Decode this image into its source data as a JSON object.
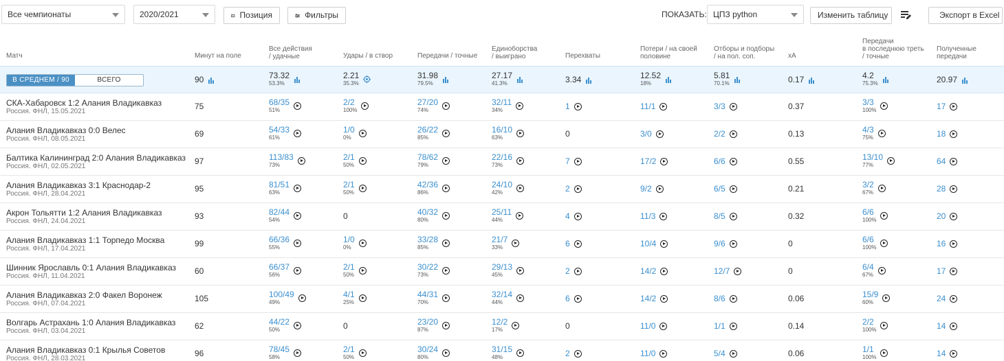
{
  "toolbar": {
    "championship": "Все чемпионаты",
    "season": "2020/2021",
    "position_label": "Позиция",
    "filters_label": "Фильтры",
    "show_label": "ПОКАЗАТЬ:",
    "show_value": "ЦПЗ python",
    "change_table_label": "Изменить таблицу",
    "export_label": "Экспорт в Excel"
  },
  "headers": [
    [
      "Матч"
    ],
    [
      "Минут на поле"
    ],
    [
      "Все действия",
      "/ удачные"
    ],
    [
      "Удары / в створ"
    ],
    [
      "Передачи / точные"
    ],
    [
      "Единоборства",
      "/ выиграно"
    ],
    [
      "Перехваты"
    ],
    [
      "Потери / на своей",
      "половине"
    ],
    [
      "Отборы и подборы",
      "/ на пол. соп."
    ],
    [
      "xA"
    ],
    [
      "Передачи",
      "в последнюю треть",
      "/ точные"
    ],
    [
      "Полученные",
      "передачи"
    ]
  ],
  "toggle": {
    "avg": "В СРЕДНЕМ / 90",
    "total": "ВСЕГО"
  },
  "average": [
    {
      "v": "90",
      "s": "",
      "icon": "bar"
    },
    {
      "v": "73.32",
      "s": "53.3%",
      "icon": "bar"
    },
    {
      "v": "2.21",
      "s": "35.3%",
      "icon": "target"
    },
    {
      "v": "31.98",
      "s": "79.5%",
      "icon": "bar"
    },
    {
      "v": "27.17",
      "s": "41.3%",
      "icon": "bar"
    },
    {
      "v": "3.34",
      "s": "",
      "icon": "bar"
    },
    {
      "v": "12.52",
      "s": "18%",
      "icon": "bar"
    },
    {
      "v": "5.81",
      "s": "70.1%",
      "icon": "bar"
    },
    {
      "v": "0.17",
      "s": "",
      "icon": "bar"
    },
    {
      "v": "4.2",
      "s": "75.3%",
      "icon": "bar"
    },
    {
      "v": "20.97",
      "s": "",
      "icon": "bar"
    }
  ],
  "rows": [
    {
      "match": "СКА-Хабаровск 1:2 Алания Владикавказ",
      "sub": "Россия. ФНЛ, 15.05.2021",
      "cells": [
        [
          "75",
          "",
          0
        ],
        [
          "68/35",
          "51%",
          1
        ],
        [
          "2/2",
          "100%",
          1
        ],
        [
          "27/20",
          "74%",
          1
        ],
        [
          "32/11",
          "34%",
          1
        ],
        [
          "1",
          "",
          1
        ],
        [
          "11/1",
          "",
          1
        ],
        [
          "3/3",
          "",
          1
        ],
        [
          "0.37",
          "",
          0
        ],
        [
          "3/3",
          "100%",
          1
        ],
        [
          "17",
          "",
          1
        ]
      ]
    },
    {
      "match": "Алания Владикавказ 0:0 Велес",
      "sub": "Россия. ФНЛ, 08.05.2021",
      "cells": [
        [
          "69",
          "",
          0
        ],
        [
          "54/33",
          "61%",
          1
        ],
        [
          "1/0",
          "0%",
          1
        ],
        [
          "26/22",
          "85%",
          1
        ],
        [
          "16/10",
          "63%",
          1
        ],
        [
          "0",
          "",
          0
        ],
        [
          "3/0",
          "",
          1
        ],
        [
          "2/2",
          "",
          1
        ],
        [
          "0.13",
          "",
          0
        ],
        [
          "4/3",
          "75%",
          1
        ],
        [
          "18",
          "",
          1
        ]
      ]
    },
    {
      "match": "Балтика Калининград 2:0 Алания Владикавказ",
      "sub": "Россия. ФНЛ, 02.05.2021",
      "cells": [
        [
          "97",
          "",
          0
        ],
        [
          "113/83",
          "73%",
          1
        ],
        [
          "2/1",
          "50%",
          1
        ],
        [
          "78/62",
          "79%",
          1
        ],
        [
          "22/16",
          "73%",
          1
        ],
        [
          "7",
          "",
          1
        ],
        [
          "17/2",
          "",
          1
        ],
        [
          "6/6",
          "",
          1
        ],
        [
          "0.55",
          "",
          0
        ],
        [
          "13/10",
          "77%",
          1
        ],
        [
          "64",
          "",
          1
        ]
      ]
    },
    {
      "match": "Алания Владикавказ 3:1 Краснодар-2",
      "sub": "Россия. ФНЛ, 28.04.2021",
      "cells": [
        [
          "95",
          "",
          0
        ],
        [
          "81/51",
          "63%",
          1
        ],
        [
          "2/1",
          "50%",
          1
        ],
        [
          "42/36",
          "86%",
          1
        ],
        [
          "24/10",
          "42%",
          1
        ],
        [
          "2",
          "",
          1
        ],
        [
          "9/2",
          "",
          1
        ],
        [
          "6/5",
          "",
          1
        ],
        [
          "0.21",
          "",
          0
        ],
        [
          "3/2",
          "67%",
          1
        ],
        [
          "28",
          "",
          1
        ]
      ]
    },
    {
      "match": "Акрон Тольятти 1:2 Алания Владикавказ",
      "sub": "Россия. ФНЛ, 24.04.2021",
      "cells": [
        [
          "93",
          "",
          0
        ],
        [
          "82/44",
          "54%",
          1
        ],
        [
          "0",
          "",
          0
        ],
        [
          "40/32",
          "80%",
          1
        ],
        [
          "25/11",
          "44%",
          1
        ],
        [
          "4",
          "",
          1
        ],
        [
          "11/3",
          "",
          1
        ],
        [
          "8/5",
          "",
          1
        ],
        [
          "0.32",
          "",
          0
        ],
        [
          "6/6",
          "100%",
          1
        ],
        [
          "20",
          "",
          1
        ]
      ]
    },
    {
      "match": "Алания Владикавказ 1:1 Торпедо Москва",
      "sub": "Россия. ФНЛ, 17.04.2021",
      "cells": [
        [
          "99",
          "",
          0
        ],
        [
          "66/36",
          "55%",
          1
        ],
        [
          "1/0",
          "0%",
          1
        ],
        [
          "33/28",
          "85%",
          1
        ],
        [
          "21/7",
          "33%",
          1
        ],
        [
          "6",
          "",
          1
        ],
        [
          "10/4",
          "",
          1
        ],
        [
          "9/6",
          "",
          1
        ],
        [
          "0",
          "",
          0
        ],
        [
          "6/6",
          "100%",
          1
        ],
        [
          "16",
          "",
          1
        ]
      ]
    },
    {
      "match": "Шинник Ярославль 0:1 Алания Владикавказ",
      "sub": "Россия. ФНЛ, 11.04.2021",
      "cells": [
        [
          "60",
          "",
          0
        ],
        [
          "66/37",
          "56%",
          1
        ],
        [
          "2/1",
          "50%",
          1
        ],
        [
          "30/22",
          "73%",
          1
        ],
        [
          "29/13",
          "45%",
          1
        ],
        [
          "2",
          "",
          1
        ],
        [
          "14/2",
          "",
          1
        ],
        [
          "12/7",
          "",
          1
        ],
        [
          "0",
          "",
          0
        ],
        [
          "6/4",
          "67%",
          1
        ],
        [
          "17",
          "",
          1
        ]
      ]
    },
    {
      "match": "Алания Владикавказ 2:0 Факел Воронеж",
      "sub": "Россия. ФНЛ, 07.04.2021",
      "cells": [
        [
          "105",
          "",
          0
        ],
        [
          "100/49",
          "49%",
          1
        ],
        [
          "4/1",
          "25%",
          1
        ],
        [
          "44/31",
          "70%",
          1
        ],
        [
          "32/14",
          "44%",
          1
        ],
        [
          "6",
          "",
          1
        ],
        [
          "14/2",
          "",
          1
        ],
        [
          "8/6",
          "",
          1
        ],
        [
          "0.06",
          "",
          0
        ],
        [
          "15/9",
          "60%",
          1
        ],
        [
          "24",
          "",
          1
        ]
      ]
    },
    {
      "match": "Волгарь Астрахань 1:0 Алания Владикавказ",
      "sub": "Россия. ФНЛ, 03.04.2021",
      "cells": [
        [
          "62",
          "",
          0
        ],
        [
          "44/22",
          "50%",
          1
        ],
        [
          "0",
          "",
          0
        ],
        [
          "23/20",
          "87%",
          1
        ],
        [
          "12/2",
          "17%",
          1
        ],
        [
          "0",
          "",
          0
        ],
        [
          "11/0",
          "",
          1
        ],
        [
          "1/1",
          "",
          1
        ],
        [
          "0.14",
          "",
          0
        ],
        [
          "2/2",
          "100%",
          1
        ],
        [
          "14",
          "",
          1
        ]
      ]
    },
    {
      "match": "Алания Владикавказ 0:1 Крылья Советов",
      "sub": "Россия. ФНЛ, 28.03.2021",
      "cells": [
        [
          "96",
          "",
          0
        ],
        [
          "78/45",
          "58%",
          1
        ],
        [
          "2/1",
          "50%",
          1
        ],
        [
          "30/24",
          "80%",
          1
        ],
        [
          "31/15",
          "48%",
          1
        ],
        [
          "2",
          "",
          1
        ],
        [
          "11/0",
          "",
          1
        ],
        [
          "5/4",
          "",
          1
        ],
        [
          "0.06",
          "",
          0
        ],
        [
          "1/1",
          "100%",
          1
        ],
        [
          "14",
          "",
          1
        ]
      ]
    }
  ]
}
